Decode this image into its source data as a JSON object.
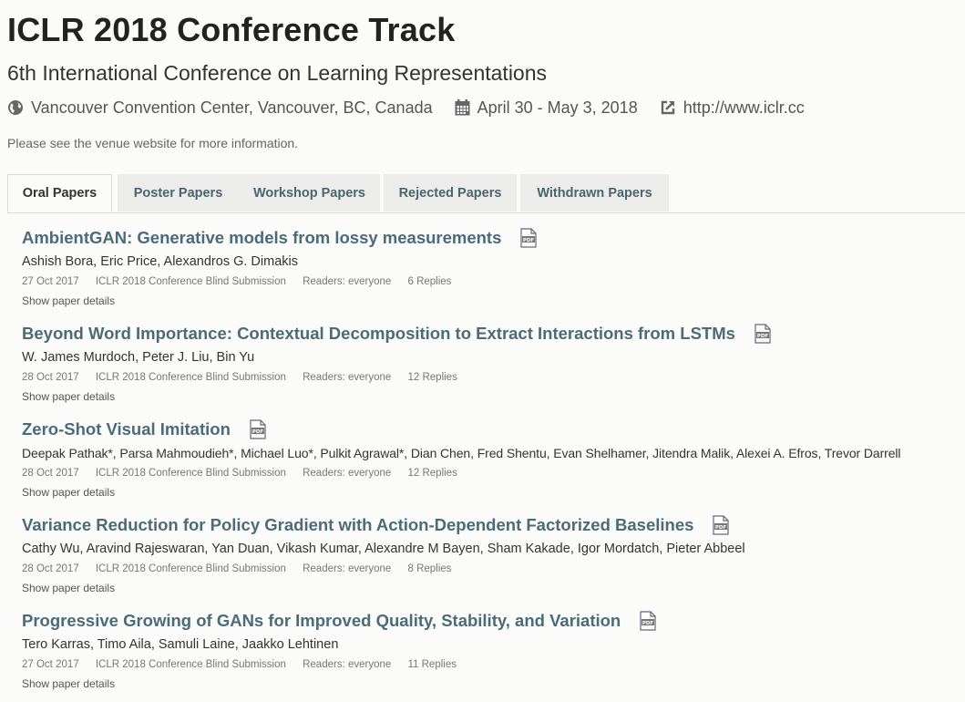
{
  "header": {
    "title": "ICLR 2018 Conference Track",
    "subtitle": "6th International Conference on Learning Representations",
    "location": "Vancouver Convention Center, Vancouver, BC, Canada",
    "dates": "April 30 - May 3, 2018",
    "website": "http://www.iclr.cc",
    "info": "Please see the venue website for more information."
  },
  "tabs": [
    {
      "label": "Oral Papers",
      "active": true
    },
    {
      "label": "Poster Papers"
    },
    {
      "label": "Workshop Papers"
    },
    {
      "label": "Rejected Papers"
    },
    {
      "label": "Withdrawn Papers"
    }
  ],
  "papers": [
    {
      "title": "AmbientGAN: Generative models from lossy measurements",
      "authors": "Ashish Bora, Eric Price, Alexandros G. Dimakis",
      "date": "27 Oct 2017",
      "invitation": "ICLR 2018 Conference Blind Submission",
      "readers": "Readers: everyone",
      "replies": "6 Replies",
      "details": "Show paper details"
    },
    {
      "title": "Beyond Word Importance: Contextual Decomposition to Extract Interactions from LSTMs",
      "authors": "W. James Murdoch, Peter J. Liu, Bin Yu",
      "date": "28 Oct 2017",
      "invitation": "ICLR 2018 Conference Blind Submission",
      "readers": "Readers: everyone",
      "replies": "12 Replies",
      "details": "Show paper details"
    },
    {
      "title": "Zero-Shot Visual Imitation",
      "authors": "Deepak Pathak*, Parsa Mahmoudieh*, Michael Luo*, Pulkit Agrawal*, Dian Chen, Fred Shentu, Evan Shelhamer, Jitendra Malik, Alexei A. Efros, Trevor Darrell",
      "date": "28 Oct 2017",
      "invitation": "ICLR 2018 Conference Blind Submission",
      "readers": "Readers: everyone",
      "replies": "12 Replies",
      "details": "Show paper details"
    },
    {
      "title": "Variance Reduction for Policy Gradient with Action-Dependent Factorized Baselines",
      "authors": "Cathy Wu, Aravind Rajeswaran, Yan Duan, Vikash Kumar, Alexandre M Bayen, Sham Kakade, Igor Mordatch, Pieter Abbeel",
      "date": "28 Oct 2017",
      "invitation": "ICLR 2018 Conference Blind Submission",
      "readers": "Readers: everyone",
      "replies": "8 Replies",
      "details": "Show paper details"
    },
    {
      "title": "Progressive Growing of GANs for Improved Quality, Stability, and Variation",
      "authors": "Tero Karras, Timo Aila, Samuli Laine, Jaakko Lehtinen",
      "date": "27 Oct 2017",
      "invitation": "ICLR 2018 Conference Blind Submission",
      "readers": "Readers: everyone",
      "replies": "11 Replies",
      "details": "Show paper details"
    }
  ],
  "icons": {
    "location": "globe-icon",
    "dates": "calendar-icon",
    "website": "external-link-icon",
    "pdf": "pdf-icon"
  }
}
